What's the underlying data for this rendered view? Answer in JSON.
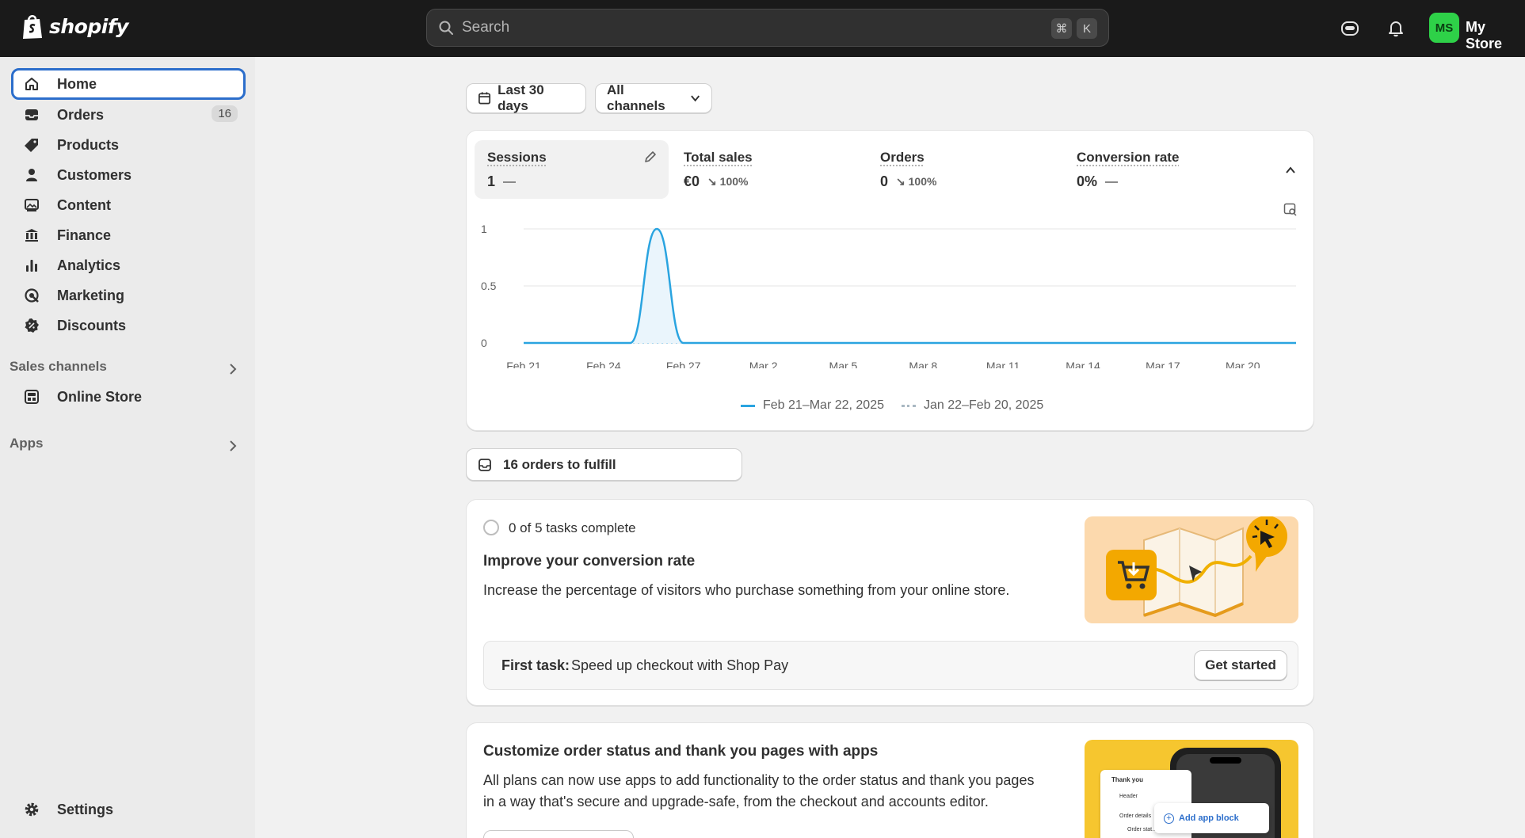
{
  "topbar": {
    "logo_text": "shopify",
    "search_placeholder": "Search",
    "shortcut_key1": "⌘",
    "shortcut_key2": "K",
    "avatar_initials": "MS",
    "store_name": "My Store"
  },
  "sidebar": {
    "items": [
      {
        "label": "Home",
        "icon": "home-icon"
      },
      {
        "label": "Orders",
        "icon": "inbox-icon",
        "badge": "16"
      },
      {
        "label": "Products",
        "icon": "tag-icon"
      },
      {
        "label": "Customers",
        "icon": "person-icon"
      },
      {
        "label": "Content",
        "icon": "image-icon"
      },
      {
        "label": "Finance",
        "icon": "bank-icon"
      },
      {
        "label": "Analytics",
        "icon": "bar-chart-icon"
      },
      {
        "label": "Marketing",
        "icon": "target-icon"
      },
      {
        "label": "Discounts",
        "icon": "discount-icon"
      }
    ],
    "sales_channels_label": "Sales channels",
    "online_store_label": "Online Store",
    "apps_label": "Apps",
    "settings_label": "Settings"
  },
  "filters": {
    "date_range": "Last 30 days",
    "channels": "All channels"
  },
  "metrics": [
    {
      "label": "Sessions",
      "value": "1",
      "change": ""
    },
    {
      "label": "Total sales",
      "value": "€0",
      "change": "100%"
    },
    {
      "label": "Orders",
      "value": "0",
      "change": "100%"
    },
    {
      "label": "Conversion rate",
      "value": "0%",
      "change": ""
    }
  ],
  "chart_data": {
    "type": "line",
    "title": "",
    "xlabel": "",
    "ylabel": "",
    "ylim": [
      0,
      1
    ],
    "y_ticks": [
      "1",
      "0.5",
      "0"
    ],
    "x_tick_labels": [
      "Feb 21",
      "Feb 24",
      "Feb 27",
      "Mar 2",
      "Mar 5",
      "Mar 8",
      "Mar 11",
      "Mar 14",
      "Mar 17",
      "Mar 20"
    ],
    "x_dates": [
      "Feb 21",
      "Feb 22",
      "Feb 23",
      "Feb 24",
      "Feb 25",
      "Feb 26",
      "Feb 27",
      "Feb 28",
      "Mar 1",
      "Mar 2",
      "Mar 3",
      "Mar 4",
      "Mar 5",
      "Mar 6",
      "Mar 7",
      "Mar 8",
      "Mar 9",
      "Mar 10",
      "Mar 11",
      "Mar 12",
      "Mar 13",
      "Mar 14",
      "Mar 15",
      "Mar 16",
      "Mar 17",
      "Mar 18",
      "Mar 19",
      "Mar 20",
      "Mar 21",
      "Mar 22"
    ],
    "series": [
      {
        "name": "Feb 21–Mar 22, 2025",
        "color": "#2aa4e0",
        "style": "solid",
        "values": [
          0,
          0,
          0,
          0,
          0,
          1,
          0,
          0,
          0,
          0,
          0,
          0,
          0,
          0,
          0,
          0,
          0,
          0,
          0,
          0,
          0,
          0,
          0,
          0,
          0,
          0,
          0,
          0,
          0,
          0
        ]
      },
      {
        "name": "Jan 22–Feb 20, 2025",
        "color": "#a6d7f1",
        "style": "dotted",
        "values": [
          0,
          0,
          0,
          0,
          0,
          0,
          0,
          0,
          0,
          0,
          0,
          0,
          0,
          0,
          0,
          0,
          0,
          0,
          0,
          0,
          0,
          0,
          0,
          0,
          0,
          0,
          0,
          0,
          0,
          0
        ]
      }
    ],
    "grid": true,
    "legend_position": "bottom-center"
  },
  "fulfill": {
    "label": "16 orders to fulfill"
  },
  "setup_card": {
    "progress": "0 of 5 tasks complete",
    "title": "Improve your conversion rate",
    "description": "Increase the percentage of visitors who purchase something from your online store.",
    "first_task_prefix": "First task:",
    "first_task_text": "Speed up checkout with Shop Pay",
    "button": "Get started"
  },
  "apps_card": {
    "title": "Customize order status and thank you pages with apps",
    "description_line1": "All plans can now use apps to add functionality to the order status and thank you pages",
    "description_line2": "in a way that's secure and upgrade-safe, from the checkout and accounts editor.",
    "illustration_thankyou": "Thank you",
    "illustration_header": "Header",
    "illustration_order_details": "Order details",
    "illustration_order_status": "Order stat...",
    "illustration_add_app_block": "Add app block"
  },
  "colors": {
    "accent": "#2c6ecb",
    "chart_line": "#2aa4e0",
    "avatar": "#2ed148"
  }
}
